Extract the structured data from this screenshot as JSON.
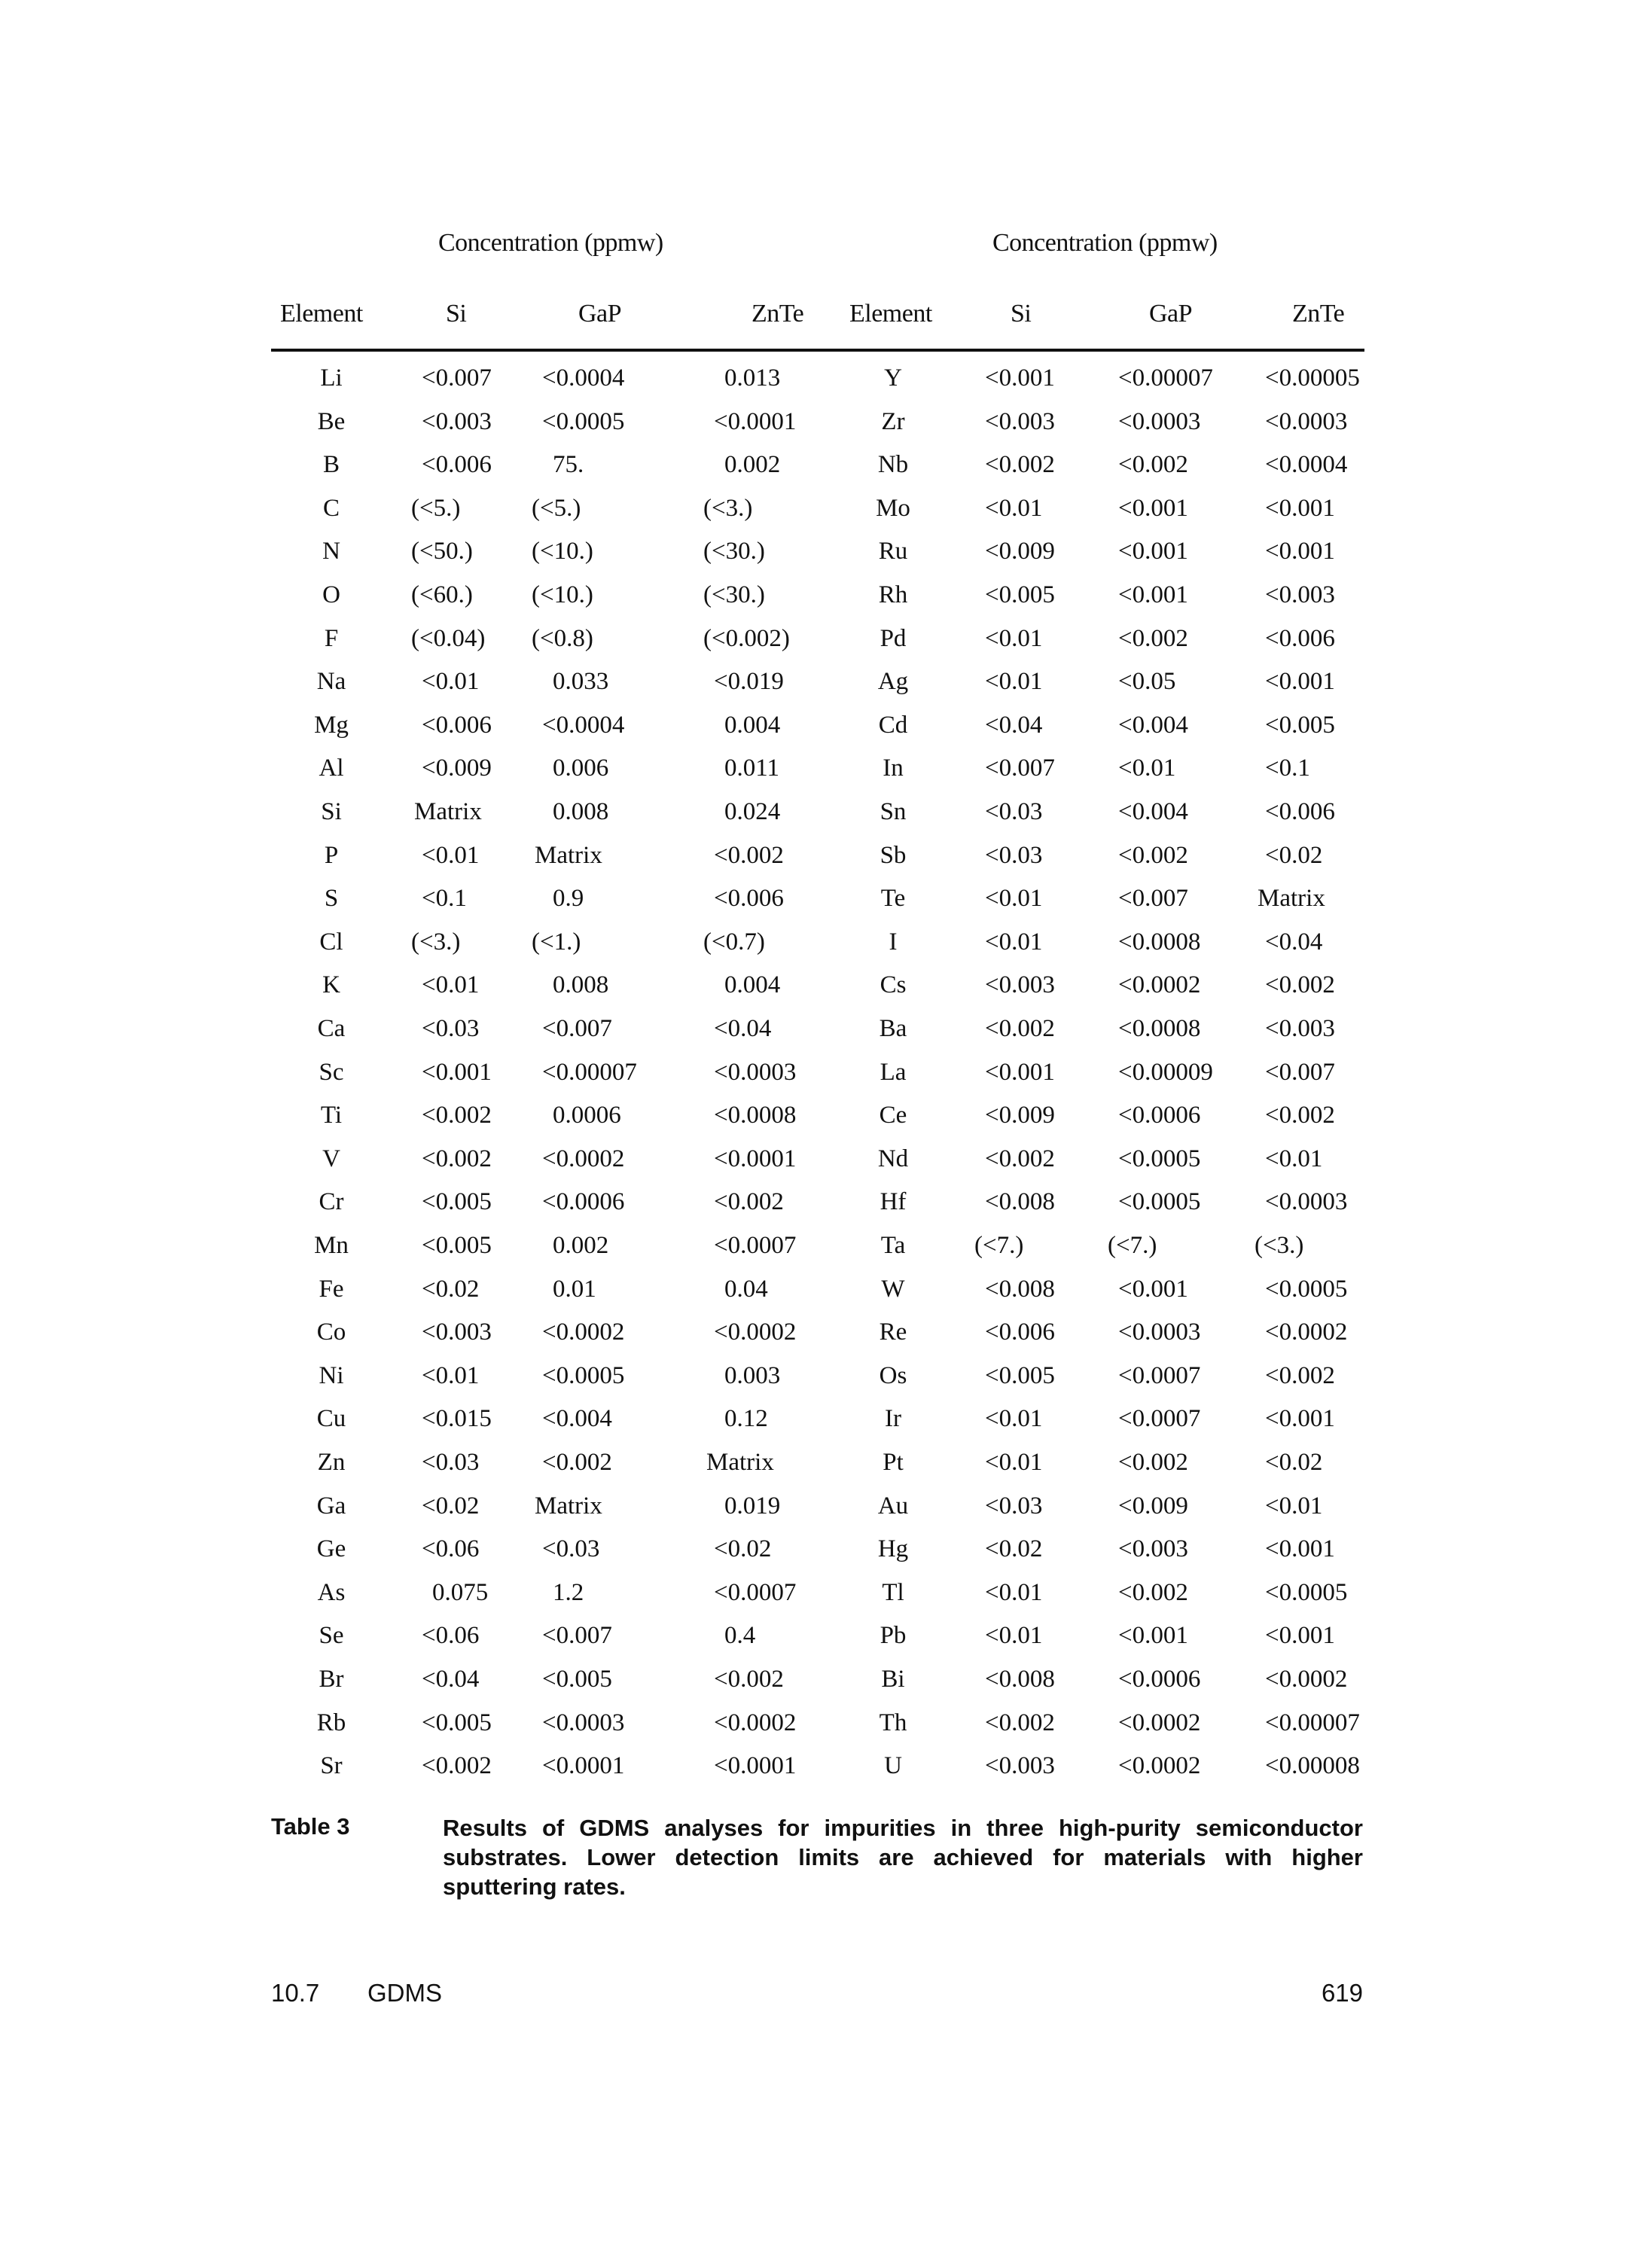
{
  "table": {
    "group_headers": [
      "Concentration (ppmw)",
      "Concentration (ppmw)"
    ],
    "column_headers": [
      "Element",
      "Si",
      "GaP",
      "ZnTe",
      "Element",
      "Si",
      "GaP",
      "ZnTe"
    ],
    "rows": [
      [
        "Li",
        "<0.007",
        "<0.0004",
        "0.013",
        "Y",
        "<0.001",
        "<0.00007",
        "<0.00005"
      ],
      [
        "Be",
        "<0.003",
        "<0.0005",
        "<0.0001",
        "Zr",
        "<0.003",
        "<0.0003",
        "<0.0003"
      ],
      [
        "B",
        "<0.006",
        "75.",
        "0.002",
        "Nb",
        "<0.002",
        "<0.002",
        "<0.0004"
      ],
      [
        "C",
        "(<5.)",
        "(<5.)",
        "(<3.)",
        "Mo",
        "<0.01",
        "<0.001",
        "<0.001"
      ],
      [
        "N",
        "(<50.)",
        "(<10.)",
        "(<30.)",
        "Ru",
        "<0.009",
        "<0.001",
        "<0.001"
      ],
      [
        "O",
        "(<60.)",
        "(<10.)",
        "(<30.)",
        "Rh",
        "<0.005",
        "<0.001",
        "<0.003"
      ],
      [
        "F",
        "(<0.04)",
        "(<0.8)",
        "(<0.002)",
        "Pd",
        "<0.01",
        "<0.002",
        "<0.006"
      ],
      [
        "Na",
        "<0.01",
        "0.033",
        "<0.019",
        "Ag",
        "<0.01",
        "<0.05",
        "<0.001"
      ],
      [
        "Mg",
        "<0.006",
        "<0.0004",
        "0.004",
        "Cd",
        "<0.04",
        "<0.004",
        "<0.005"
      ],
      [
        "Al",
        "<0.009",
        "0.006",
        "0.011",
        "In",
        "<0.007",
        "<0.01",
        "<0.1"
      ],
      [
        "Si",
        "Matrix",
        "0.008",
        "0.024",
        "Sn",
        "<0.03",
        "<0.004",
        "<0.006"
      ],
      [
        "P",
        "<0.01",
        "Matrix",
        "<0.002",
        "Sb",
        "<0.03",
        "<0.002",
        "<0.02"
      ],
      [
        "S",
        "<0.1",
        "0.9",
        "<0.006",
        "Te",
        "<0.01",
        "<0.007",
        "Matrix"
      ],
      [
        "Cl",
        "(<3.)",
        "(<1.)",
        "(<0.7)",
        "I",
        "<0.01",
        "<0.0008",
        "<0.04"
      ],
      [
        "K",
        "<0.01",
        "0.008",
        "0.004",
        "Cs",
        "<0.003",
        "<0.0002",
        "<0.002"
      ],
      [
        "Ca",
        "<0.03",
        "<0.007",
        "<0.04",
        "Ba",
        "<0.002",
        "<0.0008",
        "<0.003"
      ],
      [
        "Sc",
        "<0.001",
        "<0.00007",
        "<0.0003",
        "La",
        "<0.001",
        "<0.00009",
        "<0.007"
      ],
      [
        "Ti",
        "<0.002",
        "0.0006",
        "<0.0008",
        "Ce",
        "<0.009",
        "<0.0006",
        "<0.002"
      ],
      [
        "V",
        "<0.002",
        "<0.0002",
        "<0.0001",
        "Nd",
        "<0.002",
        "<0.0005",
        "<0.01"
      ],
      [
        "Cr",
        "<0.005",
        "<0.0006",
        "<0.002",
        "Hf",
        "<0.008",
        "<0.0005",
        "<0.0003"
      ],
      [
        "Mn",
        "<0.005",
        "0.002",
        "<0.0007",
        "Ta",
        "(<7.)",
        "(<7.)",
        "(<3.)"
      ],
      [
        "Fe",
        "<0.02",
        "0.01",
        "0.04",
        "W",
        "<0.008",
        "<0.001",
        "<0.0005"
      ],
      [
        "Co",
        "<0.003",
        "<0.0002",
        "<0.0002",
        "Re",
        "<0.006",
        "<0.0003",
        "<0.0002"
      ],
      [
        "Ni",
        "<0.01",
        "<0.0005",
        "0.003",
        "Os",
        "<0.005",
        "<0.0007",
        "<0.002"
      ],
      [
        "Cu",
        "<0.015",
        "<0.004",
        "0.12",
        "Ir",
        "<0.01",
        "<0.0007",
        "<0.001"
      ],
      [
        "Zn",
        "<0.03",
        "<0.002",
        "Matrix",
        "Pt",
        "<0.01",
        "<0.002",
        "<0.02"
      ],
      [
        "Ga",
        "<0.02",
        "Matrix",
        "0.019",
        "Au",
        "<0.03",
        "<0.009",
        "<0.01"
      ],
      [
        "Ge",
        "<0.06",
        "<0.03",
        "<0.02",
        "Hg",
        "<0.02",
        "<0.003",
        "<0.001"
      ],
      [
        "As",
        "0.075",
        "1.2",
        "<0.0007",
        "Tl",
        "<0.01",
        "<0.002",
        "<0.0005"
      ],
      [
        "Se",
        "<0.06",
        "<0.007",
        "0.4",
        "Pb",
        "<0.01",
        "<0.001",
        "<0.001"
      ],
      [
        "Br",
        "<0.04",
        "<0.005",
        "<0.002",
        "Bi",
        "<0.008",
        "<0.0006",
        "<0.0002"
      ],
      [
        "Rb",
        "<0.005",
        "<0.0003",
        "<0.0002",
        "Th",
        "<0.002",
        "<0.0002",
        "<0.00007"
      ],
      [
        "Sr",
        "<0.002",
        "<0.0001",
        "<0.0001",
        "U",
        "<0.003",
        "<0.0002",
        "<0.00008"
      ]
    ]
  },
  "caption": {
    "label": "Table 3",
    "text": "Results of GDMS analyses for impurities in three high-purity semiconductor substrates. Lower detection limits are achieved for materials with higher sputtering rates."
  },
  "footer": {
    "section": "10.7",
    "title": "GDMS",
    "page": "619"
  }
}
